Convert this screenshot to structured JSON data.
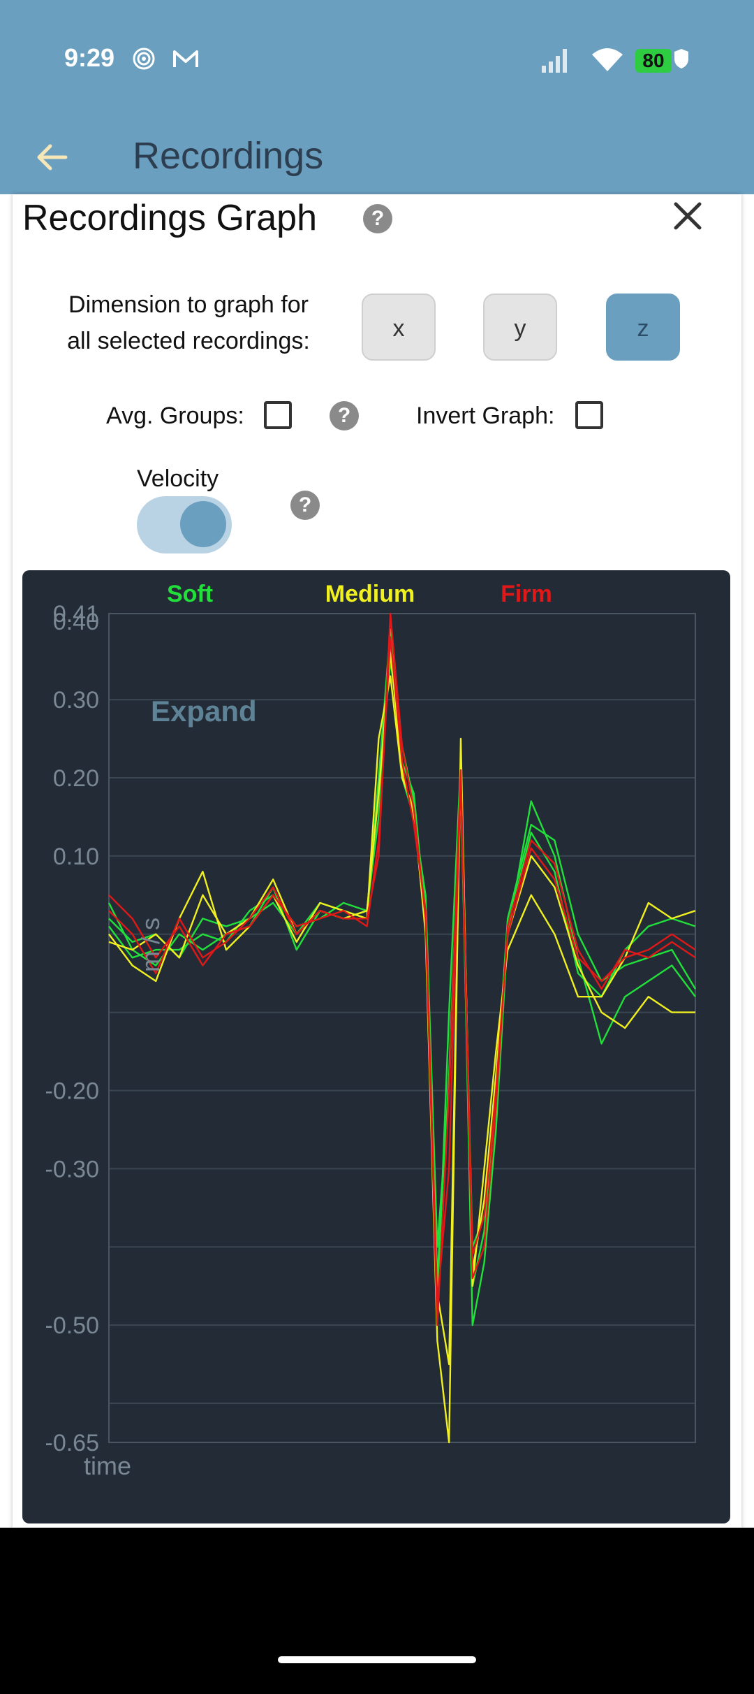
{
  "status_bar": {
    "time": "9:29",
    "battery": "80",
    "icons": [
      "notification-swirl-icon",
      "gmail-icon",
      "signal-icon",
      "wifi-icon",
      "shield-icon"
    ]
  },
  "app_bar": {
    "title": "Recordings",
    "back_icon": "arrow-left-icon"
  },
  "dialog": {
    "title": "Recordings Graph",
    "help_glyph": "?",
    "dimension_label_line1": "Dimension to graph for",
    "dimension_label_line2": "all selected recordings:",
    "dimension_buttons": [
      {
        "label": "x",
        "selected": false
      },
      {
        "label": "y",
        "selected": false
      },
      {
        "label": "z",
        "selected": true
      }
    ],
    "avg_groups_label": "Avg. Groups:",
    "avg_groups_checked": false,
    "invert_graph_label": "Invert Graph:",
    "invert_graph_checked": false,
    "velocity_label": "Velocity",
    "velocity_on": true
  },
  "colors": {
    "accent": "#6a9fc0",
    "chart_bg": "#232c36",
    "soft": "#22e03a",
    "medium": "#f0f020",
    "firm": "#e01818"
  },
  "chart_data": {
    "type": "line",
    "legend": [
      "Soft",
      "Medium",
      "Firm"
    ],
    "legend_placement": "top",
    "expand_label": "Expand",
    "xlabel": "time",
    "ylabel": "m / s",
    "y_tick_labels": [
      "0.41",
      "0.40",
      "0.30",
      "0.20",
      "0.10",
      "-0.20",
      "-0.30",
      "-0.50",
      "-0.65"
    ],
    "y_ticks": [
      0.41,
      0.4,
      0.3,
      0.2,
      0.1,
      -0.2,
      -0.3,
      -0.5,
      -0.65
    ],
    "grid_values": [
      0.41,
      0.3,
      0.2,
      0.1,
      0.0,
      -0.1,
      -0.2,
      -0.3,
      -0.4,
      -0.5,
      -0.6
    ],
    "ylim": [
      -0.65,
      0.41
    ],
    "x": [
      0,
      4,
      8,
      12,
      16,
      20,
      24,
      28,
      32,
      36,
      40,
      44,
      46,
      48,
      50,
      52,
      54,
      56,
      58,
      60,
      62,
      64,
      66,
      68,
      72,
      76,
      80,
      84,
      88,
      92,
      96,
      100
    ],
    "xlim": [
      0,
      100
    ],
    "series": [
      {
        "group": "Soft",
        "values": [
          0.04,
          -0.02,
          -0.04,
          0.0,
          -0.02,
          0.0,
          0.01,
          0.06,
          -0.02,
          0.03,
          0.02,
          0.03,
          0.15,
          0.37,
          0.2,
          0.15,
          0.05,
          -0.4,
          -0.2,
          0.19,
          -0.45,
          -0.38,
          -0.2,
          0.02,
          0.14,
          0.12,
          0.0,
          -0.06,
          -0.04,
          -0.03,
          -0.02,
          -0.07
        ]
      },
      {
        "group": "Soft",
        "values": [
          0.02,
          -0.01,
          0.0,
          -0.03,
          0.02,
          0.01,
          0.02,
          0.04,
          0.0,
          0.04,
          0.03,
          0.02,
          0.2,
          0.39,
          0.22,
          0.18,
          0.02,
          -0.48,
          -0.1,
          0.22,
          -0.5,
          -0.42,
          -0.25,
          0.0,
          0.17,
          0.1,
          -0.03,
          -0.14,
          -0.08,
          -0.06,
          -0.04,
          -0.08
        ]
      },
      {
        "group": "Soft",
        "values": [
          0.01,
          -0.03,
          -0.02,
          -0.02,
          0.0,
          -0.01,
          0.03,
          0.05,
          0.01,
          0.02,
          0.04,
          0.03,
          0.18,
          0.35,
          0.24,
          0.17,
          0.03,
          -0.44,
          -0.18,
          0.2,
          -0.4,
          -0.36,
          -0.22,
          0.01,
          0.13,
          0.08,
          -0.05,
          -0.08,
          -0.02,
          0.01,
          0.02,
          0.01
        ]
      },
      {
        "group": "Medium",
        "values": [
          0.0,
          -0.04,
          -0.06,
          0.02,
          0.08,
          -0.02,
          0.01,
          0.05,
          -0.01,
          0.04,
          0.03,
          0.02,
          0.25,
          0.33,
          0.2,
          0.16,
          0.0,
          -0.52,
          -0.65,
          0.25,
          -0.45,
          -0.3,
          -0.15,
          -0.02,
          0.05,
          0.0,
          -0.08,
          -0.08,
          -0.03,
          0.04,
          0.02,
          0.03
        ]
      },
      {
        "group": "Medium",
        "values": [
          -0.01,
          -0.02,
          0.0,
          -0.03,
          0.05,
          0.0,
          0.02,
          0.07,
          0.0,
          0.03,
          0.02,
          0.03,
          0.18,
          0.36,
          0.21,
          0.15,
          0.01,
          -0.46,
          -0.55,
          0.22,
          -0.43,
          -0.34,
          -0.18,
          0.0,
          0.1,
          0.06,
          -0.04,
          -0.1,
          -0.12,
          -0.08,
          -0.1,
          -0.1
        ]
      },
      {
        "group": "Firm",
        "values": [
          0.03,
          0.0,
          -0.05,
          0.02,
          -0.03,
          -0.01,
          0.02,
          0.06,
          0.0,
          0.03,
          0.02,
          0.02,
          0.1,
          0.41,
          0.24,
          0.16,
          0.02,
          -0.5,
          -0.2,
          0.21,
          -0.44,
          -0.4,
          -0.22,
          0.01,
          0.12,
          0.09,
          -0.02,
          -0.07,
          -0.02,
          -0.03,
          -0.01,
          -0.03
        ]
      },
      {
        "group": "Firm",
        "values": [
          0.05,
          0.02,
          -0.03,
          0.01,
          -0.04,
          0.0,
          0.01,
          0.05,
          0.01,
          0.02,
          0.03,
          0.01,
          0.12,
          0.38,
          0.22,
          0.14,
          0.03,
          -0.47,
          -0.3,
          0.2,
          -0.41,
          -0.36,
          -0.2,
          0.0,
          0.11,
          0.07,
          -0.03,
          -0.06,
          -0.03,
          -0.02,
          0.0,
          -0.02
        ]
      }
    ]
  }
}
